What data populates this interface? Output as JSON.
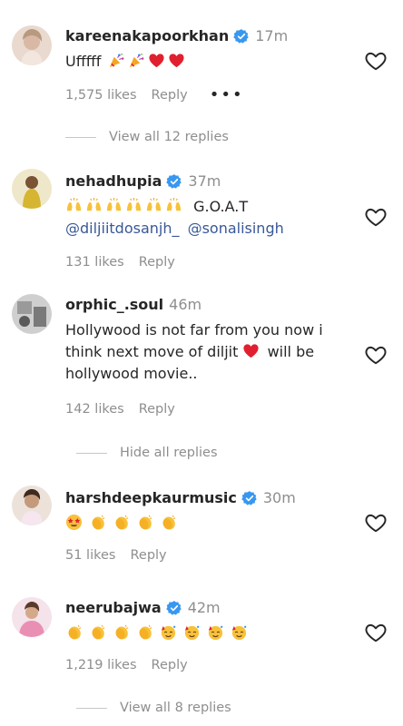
{
  "comments": [
    {
      "username": "kareenakapoorkhan",
      "verified": true,
      "time": "17m",
      "text": "Ufffff",
      "likes": "1,575 likes",
      "reply": "Reply",
      "more": "•••",
      "view_replies": "View all 12 replies"
    },
    {
      "username": "nehadhupia",
      "verified": true,
      "time": "37m",
      "text": "G.O.A.T",
      "mention1": "@diljiitdosanjh_",
      "mention2": "@sonalisingh",
      "likes": "131 likes",
      "reply": "Reply"
    },
    {
      "username": "orphic_.soul",
      "verified": false,
      "time": "46m",
      "text_line1": "Hollywood is not far from you now i",
      "text_line2a": "think next move of diljit",
      "text_line2b": "will be",
      "text_line3": "hollywood movie..",
      "likes": "142 likes",
      "reply": "Reply",
      "hide_replies": "Hide all replies"
    },
    {
      "username": "harshdeepkaurmusic",
      "verified": true,
      "time": "30m",
      "likes": "51 likes",
      "reply": "Reply"
    },
    {
      "username": "neerubajwa",
      "verified": true,
      "time": "42m",
      "likes": "1,219 likes",
      "reply": "Reply",
      "view_replies": "View all 8 replies"
    }
  ],
  "icons": {
    "like": "heart-outline-icon",
    "verified": "verified-badge-icon",
    "party": "party-popper-emoji",
    "heart": "red-heart-emoji",
    "praise": "raising-hands-emoji",
    "clap": "clapping-hands-emoji",
    "star_eyes": "star-struck-emoji"
  },
  "colors": {
    "text": "#262626",
    "secondary": "#8e8e8e",
    "verified": "#3897f0",
    "mention": "#385898",
    "heart": "#e0202f"
  }
}
